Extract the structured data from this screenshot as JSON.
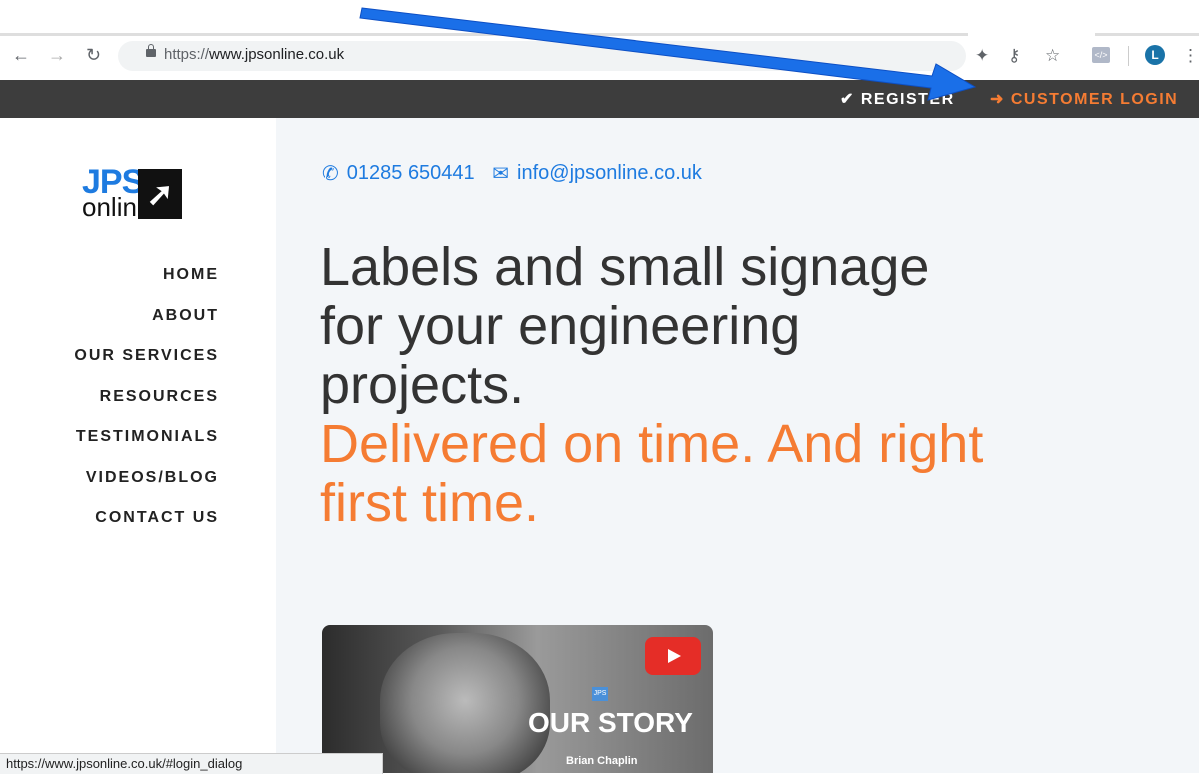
{
  "browser": {
    "url_prefix": "https://",
    "url_host": "www.jpsonline.co.uk",
    "avatar_letter": "L",
    "status_url": "https://www.jpsonline.co.uk/#login_dialog"
  },
  "topbar": {
    "register": "✔ REGISTER",
    "login": "➜ CUSTOMER LOGIN"
  },
  "logo": {
    "jps": "JPS",
    "online": "online",
    "arrow": "➚"
  },
  "nav": [
    "HOME",
    "ABOUT",
    "OUR SERVICES",
    "RESOURCES",
    "TESTIMONIALS",
    "VIDEOS/BLOG",
    "CONTACT US"
  ],
  "contact": {
    "phone": "01285 650441",
    "email": "info@jpsonline.co.uk"
  },
  "hero": {
    "line1": "Labels and small signage",
    "line2": "for your engineering",
    "line3": "projects.",
    "tagline": "Delivered on time. And right first time."
  },
  "video": {
    "title": "OUR STORY",
    "logo": "JPS",
    "name": "Brian Chaplin"
  },
  "colors": {
    "accent": "#f57c33",
    "brand_blue": "#1e7be0",
    "topbar": "#3d3d3d"
  }
}
